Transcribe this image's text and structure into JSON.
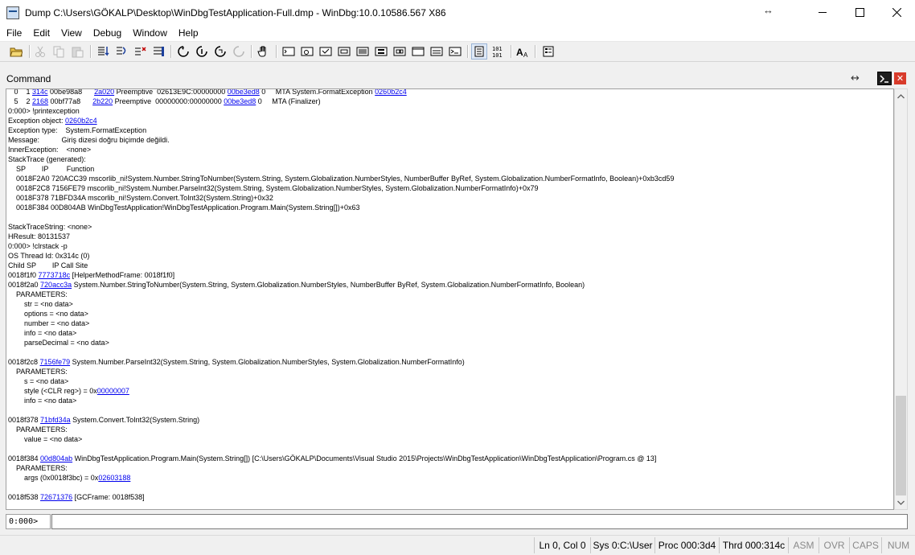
{
  "window": {
    "title": "Dump C:\\Users\\GÖKALP\\Desktop\\WinDbgTestApplication-Full.dmp - WinDbg:10.0.10586.567 X86",
    "resize_glyph": "↔"
  },
  "menu": {
    "items": [
      "File",
      "Edit",
      "View",
      "Debug",
      "Window",
      "Help"
    ]
  },
  "toolbar": {
    "icons": [
      "open-icon",
      "cut-icon",
      "copy-icon",
      "paste-icon",
      "step-into-icon",
      "step-over-icon",
      "step-out-icon",
      "run-to-cursor-icon",
      "go-icon",
      "break-icon",
      "restart-icon",
      "stop-icon",
      "hand-icon",
      "command-window-icon",
      "watch-window-icon",
      "locals-window-icon",
      "registers-window-icon",
      "memory-window-icon",
      "call-stack-window-icon",
      "disassembly-window-icon",
      "scratch-pad-icon",
      "processes-threads-icon",
      "source-mode-icon",
      "hex-mode-icon",
      "font-icon",
      "options-icon"
    ]
  },
  "command_panel": {
    "title": "Command",
    "dock_glyph": "↔",
    "close_glyph": "✕"
  },
  "output_lines": [
    [
      {
        "t": "   0    1 "
      },
      {
        "t": "314c",
        "l": 1
      },
      {
        "t": " 00be98a8      "
      },
      {
        "t": "2a020",
        "l": 1
      },
      {
        "t": " Preemptive  02613E9C:00000000 "
      },
      {
        "t": "00be3ed8",
        "l": 1
      },
      {
        "t": " 0     MTA System.FormatException "
      },
      {
        "t": "0260b2c4",
        "l": 1
      }
    ],
    [
      {
        "t": "   5    2 "
      },
      {
        "t": "2168",
        "l": 1
      },
      {
        "t": " 00bf77a8      "
      },
      {
        "t": "2b220",
        "l": 1
      },
      {
        "t": " Preemptive  00000000:00000000 "
      },
      {
        "t": "00be3ed8",
        "l": 1
      },
      {
        "t": " 0     MTA (Finalizer)"
      }
    ],
    [
      {
        "t": "0:000> !printexception"
      }
    ],
    [
      {
        "t": "Exception object: "
      },
      {
        "t": "0260b2c4",
        "l": 1
      }
    ],
    [
      {
        "t": "Exception type:    System.FormatException"
      }
    ],
    [
      {
        "t": "Message:           Giriş dizesi doğru biçimde değildi."
      }
    ],
    [
      {
        "t": "InnerException:    <none>"
      }
    ],
    [
      {
        "t": "StackTrace (generated):"
      }
    ],
    [
      {
        "t": "    SP        IP         Function"
      }
    ],
    [
      {
        "t": "    0018F2A0 720ACC39 mscorlib_ni!System.Number.StringToNumber(System.String, System.Globalization.NumberStyles, NumberBuffer ByRef, System.Globalization.NumberFormatInfo, Boolean)+0xb3cd59"
      }
    ],
    [
      {
        "t": "    0018F2C8 7156FE79 mscorlib_ni!System.Number.ParseInt32(System.String, System.Globalization.NumberStyles, System.Globalization.NumberFormatInfo)+0x79"
      }
    ],
    [
      {
        "t": "    0018F378 71BFD34A mscorlib_ni!System.Convert.ToInt32(System.String)+0x32"
      }
    ],
    [
      {
        "t": "    0018F384 00D804AB WinDbgTestApplication!WinDbgTestApplication.Program.Main(System.String[])+0x63"
      }
    ],
    [
      {
        "t": ""
      }
    ],
    [
      {
        "t": "StackTraceString: <none>"
      }
    ],
    [
      {
        "t": "HResult: 80131537"
      }
    ],
    [
      {
        "t": "0:000> !clrstack -p"
      }
    ],
    [
      {
        "t": "OS Thread Id: 0x314c (0)"
      }
    ],
    [
      {
        "t": "Child SP        IP Call Site"
      }
    ],
    [
      {
        "t": "0018f1f0 "
      },
      {
        "t": "7773718c",
        "l": 1
      },
      {
        "t": " [HelperMethodFrame: 0018f1f0]"
      }
    ],
    [
      {
        "t": "0018f2a0 "
      },
      {
        "t": "720acc3a",
        "l": 1
      },
      {
        "t": " System.Number.StringToNumber(System.String, System.Globalization.NumberStyles, NumberBuffer ByRef, System.Globalization.NumberFormatInfo, Boolean)"
      }
    ],
    [
      {
        "t": "    PARAMETERS:"
      }
    ],
    [
      {
        "t": "        str = <no data>"
      }
    ],
    [
      {
        "t": "        options = <no data>"
      }
    ],
    [
      {
        "t": "        number = <no data>"
      }
    ],
    [
      {
        "t": "        info = <no data>"
      }
    ],
    [
      {
        "t": "        parseDecimal = <no data>"
      }
    ],
    [
      {
        "t": ""
      }
    ],
    [
      {
        "t": "0018f2c8 "
      },
      {
        "t": "7156fe79",
        "l": 1
      },
      {
        "t": " System.Number.ParseInt32(System.String, System.Globalization.NumberStyles, System.Globalization.NumberFormatInfo)"
      }
    ],
    [
      {
        "t": "    PARAMETERS:"
      }
    ],
    [
      {
        "t": "        s = <no data>"
      }
    ],
    [
      {
        "t": "        style (<CLR reg>) = 0x"
      },
      {
        "t": "00000007",
        "l": 1
      }
    ],
    [
      {
        "t": "        info = <no data>"
      }
    ],
    [
      {
        "t": ""
      }
    ],
    [
      {
        "t": "0018f378 "
      },
      {
        "t": "71bfd34a",
        "l": 1
      },
      {
        "t": " System.Convert.ToInt32(System.String)"
      }
    ],
    [
      {
        "t": "    PARAMETERS:"
      }
    ],
    [
      {
        "t": "        value = <no data>"
      }
    ],
    [
      {
        "t": ""
      }
    ],
    [
      {
        "t": "0018f384 "
      },
      {
        "t": "00d804ab",
        "l": 1
      },
      {
        "t": " WinDbgTestApplication.Program.Main(System.String[]) [C:\\Users\\GÖKALP\\Documents\\Visual Studio 2015\\Projects\\WinDbgTestApplication\\WinDbgTestApplication\\Program.cs @ 13]"
      }
    ],
    [
      {
        "t": "    PARAMETERS:"
      }
    ],
    [
      {
        "t": "        args (0x0018f3bc) = 0x"
      },
      {
        "t": "02603188",
        "l": 1
      }
    ],
    [
      {
        "t": ""
      }
    ],
    [
      {
        "t": "0018f538 "
      },
      {
        "t": "72671376",
        "l": 1
      },
      {
        "t": " [GCFrame: 0018f538]"
      }
    ]
  ],
  "command_input": {
    "prompt": "0:000>",
    "value": ""
  },
  "statusbar": {
    "position": "Ln 0, Col 0",
    "system": "Sys 0:C:\\User",
    "process": "Proc 000:3d4",
    "thread": "Thrd 000:314c",
    "asm": "ASM",
    "ovr": "OVR",
    "caps": "CAPS",
    "num": "NUM"
  },
  "scrollbar": {
    "position_fraction": 0.78
  }
}
